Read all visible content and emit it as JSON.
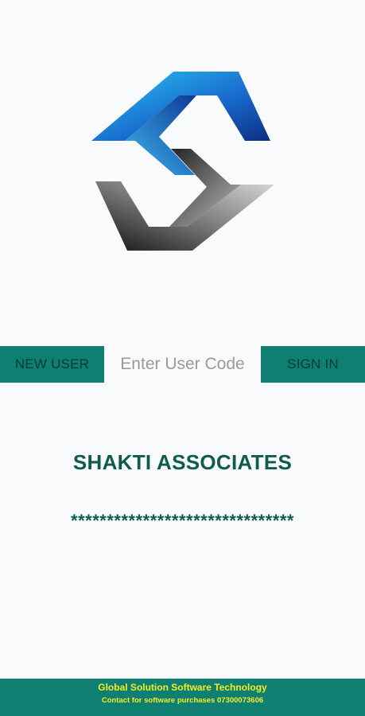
{
  "logo": {
    "icon": "s-shape-logo-icon"
  },
  "login": {
    "new_user_label": "NEW USER",
    "user_code_value": "",
    "user_code_placeholder": "Enter User Code",
    "sign_in_label": "SIGN IN"
  },
  "company": {
    "name": "SHAKTI ASSOCIATES",
    "masked_text": "*******************************"
  },
  "footer": {
    "line1": "Global Solution Software Technology",
    "line2": "Contact for software purchases 07300073606"
  },
  "colors": {
    "accent": "#0e7f71",
    "title": "#0f5b4c",
    "footer_text": "#f5ec27",
    "background": "#f9fafb"
  }
}
